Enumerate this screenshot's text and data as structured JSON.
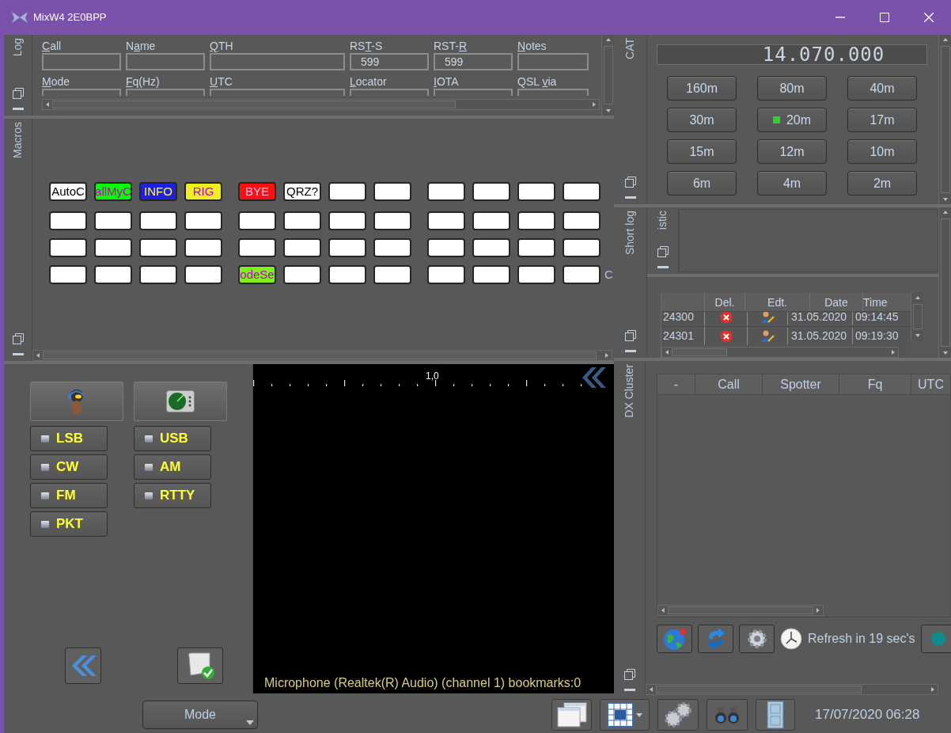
{
  "window": {
    "title": "MixW4 2E0BPP"
  },
  "log": {
    "tab": "Log",
    "fields": [
      {
        "label": {
          "key": "C",
          "after": "all"
        }
      },
      {
        "label": {
          "before": "N",
          "key": "a",
          "after": "me"
        }
      },
      {
        "label": {
          "key": "Q",
          "after": "TH"
        }
      },
      {
        "label": {
          "before": "RS",
          "key": "T",
          "after": "-S"
        },
        "value": "599"
      },
      {
        "label": {
          "before": "RST-",
          "key": "R"
        },
        "value": "599"
      },
      {
        "label": {
          "key": "N",
          "after": "otes"
        }
      },
      {
        "label": {
          "key": "M",
          "after": "ode"
        }
      },
      {
        "label": {
          "key": "F",
          "after": "q(Hz)"
        }
      },
      {
        "label": {
          "key": "U",
          "after": "TC"
        }
      },
      {
        "label": {
          "key": "L",
          "after": "ocator"
        }
      },
      {
        "label": {
          "key": "I",
          "after": "OTA"
        }
      },
      {
        "label": {
          "before": "QSL ",
          "key": "v",
          "after": "ia"
        }
      }
    ]
  },
  "macros": {
    "tab": "Macros",
    "trailing_text": "C",
    "rows": [
      [
        {
          "label": "AutoC",
          "color": "#ffffff"
        },
        {
          "label": "allMyC",
          "color": "#00ff00"
        },
        {
          "label": "INFO",
          "color": "#2020e0"
        },
        {
          "label": "RIG",
          "color": "#f0f020"
        },
        {
          "label": "BYE",
          "color": "#ff1010"
        },
        {
          "label": "QRZ?",
          "color": "#ffffff"
        },
        {},
        {},
        {},
        {},
        {},
        {}
      ],
      [
        {},
        {},
        {},
        {},
        {},
        {},
        {},
        {},
        {},
        {},
        {},
        {}
      ],
      [
        {},
        {},
        {},
        {},
        {},
        {},
        {},
        {},
        {},
        {},
        {},
        {}
      ],
      [
        {},
        {},
        {},
        {},
        {
          "label": "odeSe",
          "color": "#80f020"
        },
        {},
        {},
        {},
        {},
        {},
        {},
        {}
      ]
    ]
  },
  "mode_panel": {
    "modes": [
      {
        "label": "LSB",
        "selected": false
      },
      {
        "label": "USB",
        "selected": false
      },
      {
        "label": "CW",
        "selected": false
      },
      {
        "label": "AM",
        "selected": false
      },
      {
        "label": "FM",
        "selected": false
      },
      {
        "label": "RTTY",
        "selected": false
      },
      {
        "label": "PKT",
        "selected": false
      }
    ]
  },
  "waterfall": {
    "scale_label": "1,0",
    "status": "Microphone (Realtek(R) Audio) (channel 1) bookmarks:0"
  },
  "cat": {
    "tab": "CAT",
    "frequency": "14.070.000",
    "bands": [
      {
        "label": "160m",
        "selected": false
      },
      {
        "label": "80m",
        "selected": false
      },
      {
        "label": "40m",
        "selected": false
      },
      {
        "label": "30m",
        "selected": false
      },
      {
        "label": "20m",
        "selected": true
      },
      {
        "label": "17m",
        "selected": false
      },
      {
        "label": "15m",
        "selected": false
      },
      {
        "label": "12m",
        "selected": false
      },
      {
        "label": "10m",
        "selected": false
      },
      {
        "label": "6m",
        "selected": false
      },
      {
        "label": "4m",
        "selected": false
      },
      {
        "label": "2m",
        "selected": false
      }
    ]
  },
  "short_log": {
    "tab": "Short log",
    "subtab": "istic",
    "columns": [
      "Del.",
      "Edt.",
      "Date",
      "Time"
    ],
    "rows": [
      {
        "id": "24300",
        "date": "31.05.2020",
        "time": "09:14:45"
      },
      {
        "id": "24301",
        "date": "31.05.2020",
        "time": "09:19:30"
      }
    ]
  },
  "dx_cluster": {
    "tab": "DX Cluster",
    "columns": [
      "-",
      "Call",
      "Spotter",
      "Fq",
      "UTC"
    ],
    "refresh_text": "Refresh in 19 sec's"
  },
  "status_bar": {
    "mode_dropdown": "Mode",
    "datetime": "17/07/2020 06:28"
  }
}
